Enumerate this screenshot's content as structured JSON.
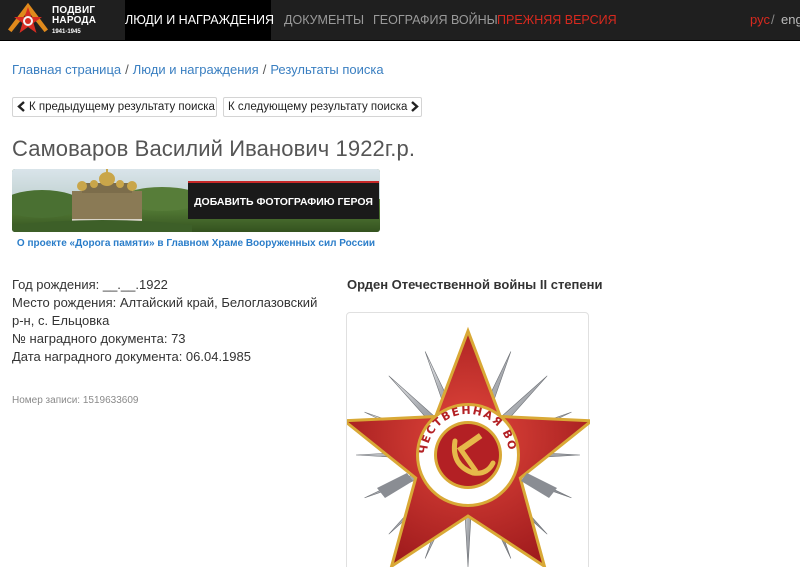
{
  "header": {
    "logo": {
      "line1": "ПОДВИГ",
      "line2": "НАРОДА",
      "years": "1941-1945"
    },
    "nav": {
      "people": "ЛЮДИ И НАГРАЖДЕНИЯ",
      "documents": "ДОКУМЕНТЫ",
      "geography": "ГЕОГРАФИЯ ВОЙНЫ",
      "old_version": "ПРЕЖНЯЯ ВЕРСИЯ"
    },
    "lang": {
      "ru": "рус",
      "separator": "/",
      "en": "eng"
    },
    "colors": {
      "bar": "#1f1f1f",
      "accent": "#d8291f"
    }
  },
  "breadcrumb": {
    "items": [
      "Главная страница",
      "Люди и награждения",
      "Результаты поиска"
    ],
    "separator": "/"
  },
  "pager": {
    "prev": "К предыдущему результату поиска",
    "next": "К следующему результату поиска",
    "prev_icon": "chevron-left-icon",
    "next_icon": "chevron-right-icon"
  },
  "person": {
    "title": "Самоваров Василий Иванович 1922г.р."
  },
  "banner": {
    "button": "ДОБАВИТЬ ФОТОГРАФИЮ ГЕРОЯ",
    "caption": "О проекте «Дорога памяти» в Главном Храме Вооруженных сил России"
  },
  "details": {
    "birth_year": "Год рождения: __.__.1922",
    "birth_place": "Место рождения: Алтайский край, Белоглазовский р-н, с. Ельцовка",
    "doc_number": "№ наградного документа: 73",
    "doc_date": "Дата наградного документа: 06.04.1985"
  },
  "record": {
    "label": "Номер записи: 1519633609"
  },
  "award": {
    "title": "Орден Отечественной войны II степени",
    "ring_text": "ОТЕЧЕСТВЕННАЯ ВОЙНА",
    "colors": {
      "star": "#c0262a",
      "ring": "#ffffff",
      "gold": "#d9a936",
      "silver": "#c9cbce"
    }
  }
}
